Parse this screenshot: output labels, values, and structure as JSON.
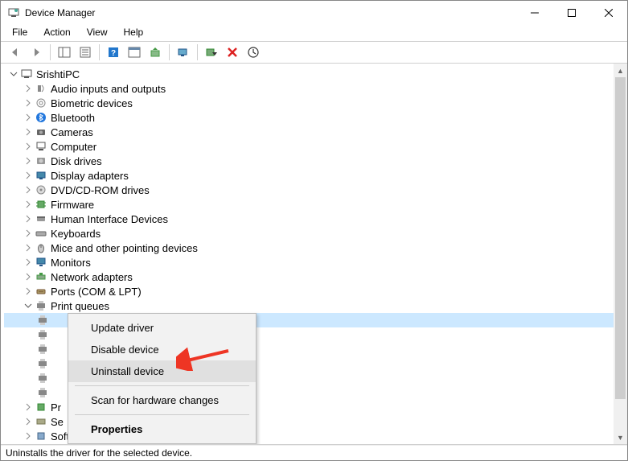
{
  "window": {
    "title": "Device Manager"
  },
  "menu": {
    "file": "File",
    "action": "Action",
    "view": "View",
    "help": "Help"
  },
  "tree": {
    "root": "SrishtiPC",
    "categories": [
      {
        "label": "Audio inputs and outputs"
      },
      {
        "label": "Biometric devices"
      },
      {
        "label": "Bluetooth"
      },
      {
        "label": "Cameras"
      },
      {
        "label": "Computer"
      },
      {
        "label": "Disk drives"
      },
      {
        "label": "Display adapters"
      },
      {
        "label": "DVD/CD-ROM drives"
      },
      {
        "label": "Firmware"
      },
      {
        "label": "Human Interface Devices"
      },
      {
        "label": "Keyboards"
      },
      {
        "label": "Mice and other pointing devices"
      },
      {
        "label": "Monitors"
      },
      {
        "label": "Network adapters"
      },
      {
        "label": "Ports (COM & LPT)"
      },
      {
        "label": "Print queues"
      }
    ],
    "partial": [
      {
        "label": "Pr"
      },
      {
        "label": "Se"
      },
      {
        "label": "Software components"
      }
    ]
  },
  "context_menu": {
    "update": "Update driver",
    "disable": "Disable device",
    "uninstall": "Uninstall device",
    "scan": "Scan for hardware changes",
    "properties": "Properties"
  },
  "status": "Uninstalls the driver for the selected device.",
  "colors": {
    "selection": "#cce8ff",
    "arrow": "#ee3524"
  }
}
